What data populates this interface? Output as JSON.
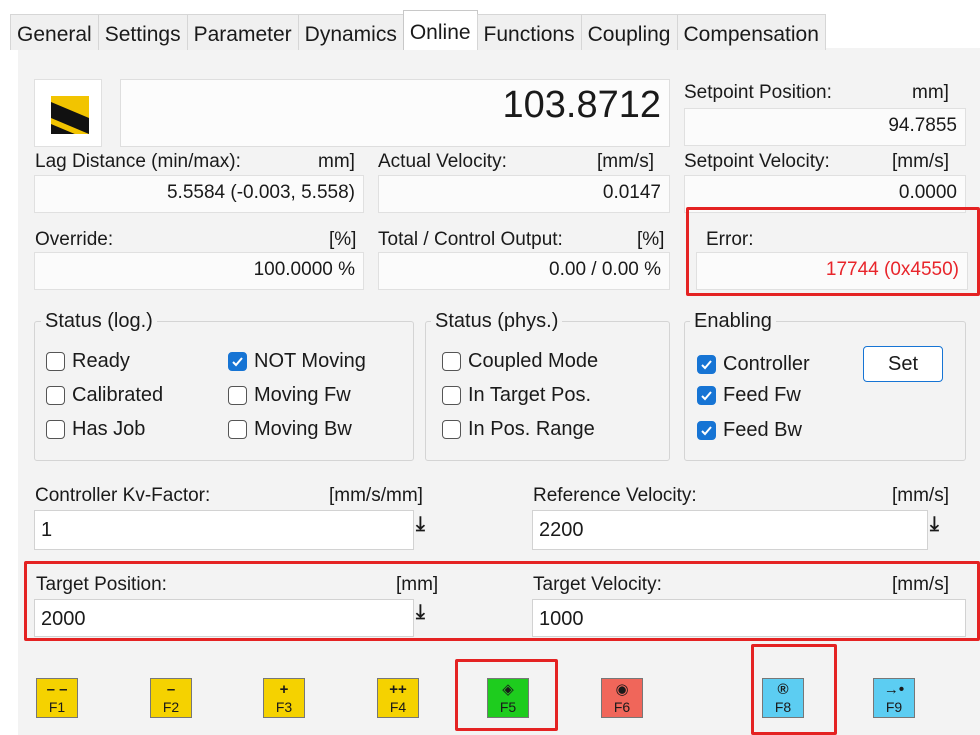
{
  "tabs": [
    "General",
    "Settings",
    "Parameter",
    "Dynamics",
    "Online",
    "Functions",
    "Coupling",
    "Compensation"
  ],
  "active_tab": "Online",
  "actual_position": "103.8712",
  "setpoint_position": {
    "label": "Setpoint Position:",
    "unit": "mm]",
    "value": "94.7855"
  },
  "lag_distance": {
    "label": "Lag Distance (min/max):",
    "unit": "mm]",
    "value": "5.5584  (-0.003, 5.558)"
  },
  "actual_velocity": {
    "label": "Actual Velocity:",
    "unit": "[mm/s]",
    "value": "0.0147"
  },
  "setpoint_velocity": {
    "label": "Setpoint Velocity:",
    "unit": "[mm/s]",
    "value": "0.0000"
  },
  "override": {
    "label": "Override:",
    "unit": "[%]",
    "value": "100.0000 %"
  },
  "total_output": {
    "label": "Total / Control Output:",
    "unit": "[%]",
    "value": "0.00 /  0.00 %"
  },
  "error": {
    "label": "Error:",
    "value": "17744 (0x4550)",
    "color": "#e8252b"
  },
  "status_log": {
    "title": "Status (log.)",
    "items": [
      {
        "label": "Ready",
        "checked": false
      },
      {
        "label": "Calibrated",
        "checked": false
      },
      {
        "label": "Has Job",
        "checked": false
      },
      {
        "label": "NOT Moving",
        "checked": true
      },
      {
        "label": "Moving Fw",
        "checked": false
      },
      {
        "label": "Moving Bw",
        "checked": false
      }
    ]
  },
  "status_phys": {
    "title": "Status (phys.)",
    "items": [
      {
        "label": "Coupled Mode",
        "checked": false
      },
      {
        "label": "In Target Pos.",
        "checked": false
      },
      {
        "label": "In Pos. Range",
        "checked": false
      }
    ]
  },
  "enabling": {
    "title": "Enabling",
    "items": [
      {
        "label": "Controller",
        "checked": true
      },
      {
        "label": "Feed Fw",
        "checked": true
      },
      {
        "label": "Feed Bw",
        "checked": true
      }
    ],
    "set_label": "Set"
  },
  "kv_factor": {
    "label": "Controller Kv-Factor:",
    "unit": "[mm/s/mm]",
    "value": "1"
  },
  "reference_velocity": {
    "label": "Reference Velocity:",
    "unit": "[mm/s]",
    "value": "2200"
  },
  "target_position": {
    "label": "Target Position:",
    "unit": "[mm]",
    "value": "2000"
  },
  "target_velocity": {
    "label": "Target Velocity:",
    "unit": "[mm/s]",
    "value": "1000"
  },
  "function_keys": [
    {
      "key": "F1",
      "symbol": "– –",
      "color": "#f5d200"
    },
    {
      "key": "F2",
      "symbol": "–",
      "color": "#f5d200"
    },
    {
      "key": "F3",
      "symbol": "+",
      "color": "#f5d200"
    },
    {
      "key": "F4",
      "symbol": "++",
      "color": "#f5d200"
    },
    {
      "key": "F5",
      "symbol": "◈",
      "color": "#1ecc1e"
    },
    {
      "key": "F6",
      "symbol": "◉",
      "color": "#f0665a"
    },
    {
      "key": "F8",
      "symbol": "®",
      "color": "#5ccdf2"
    },
    {
      "key": "F9",
      "symbol": "→•",
      "color": "#5ccdf2"
    }
  ],
  "accent_color": "#1674d4",
  "highlight_color": "#e42222"
}
